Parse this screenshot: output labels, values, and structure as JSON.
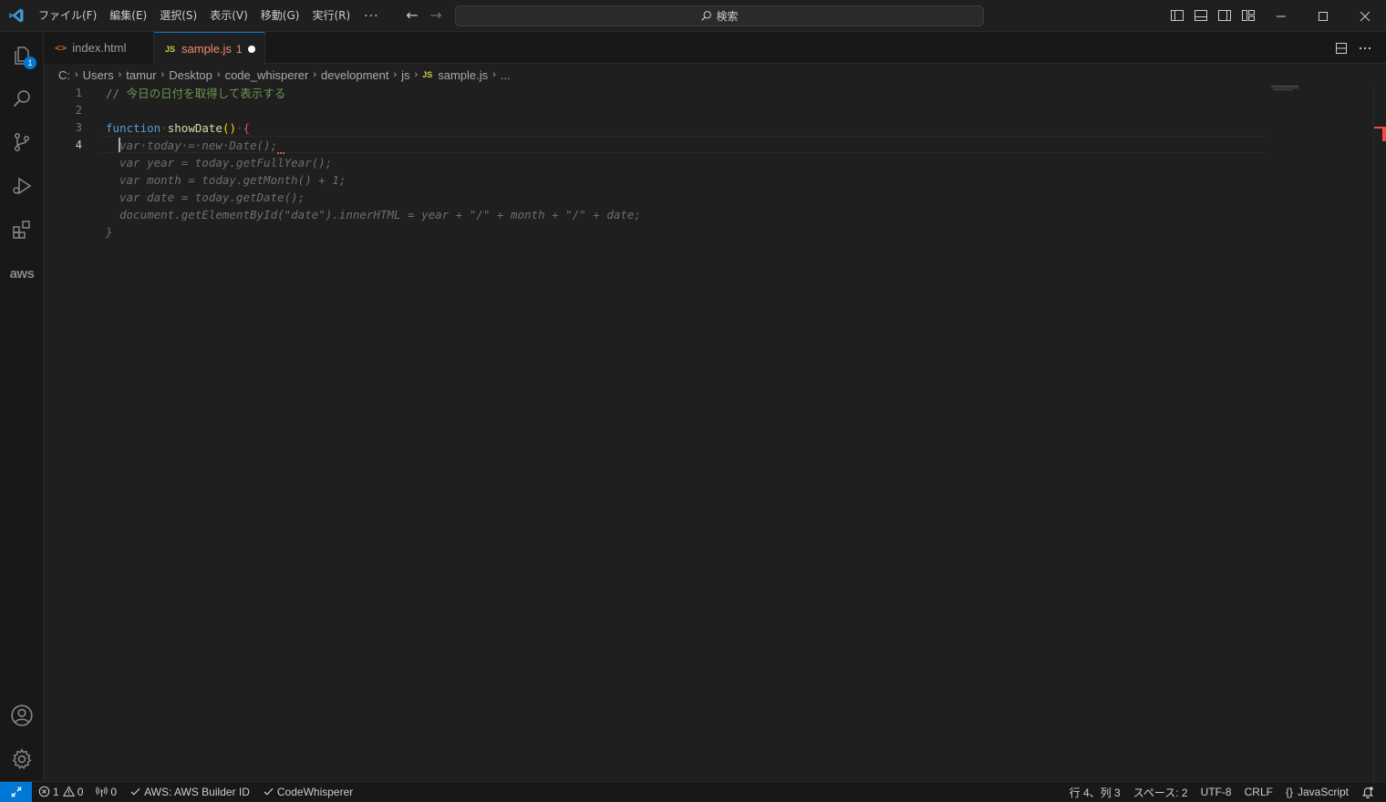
{
  "titlebar": {
    "menu": [
      "ファイル(F)",
      "編集(E)",
      "選択(S)",
      "表示(V)",
      "移動(G)",
      "実行(R)"
    ],
    "more": "···",
    "search_placeholder": "検索"
  },
  "activitybar": {
    "explorer_badge": "1",
    "aws_label": "aws"
  },
  "tabs": [
    {
      "label": "index.html",
      "icon": "html-icon",
      "active": false
    },
    {
      "label": "sample.js",
      "icon_text": "JS",
      "problems": "1",
      "active": true,
      "dirty": true
    }
  ],
  "breadcrumb": {
    "items": [
      "C:",
      "Users",
      "tamur",
      "Desktop",
      "code_whisperer",
      "development",
      "js"
    ],
    "file_icon": "JS",
    "file": "sample.js",
    "more": "..."
  },
  "editor": {
    "line_numbers": [
      "1",
      "2",
      "3",
      "4"
    ],
    "current_line": "4",
    "line1_comment": "// 今日の日付を取得して表示する",
    "line3_keyword": "function",
    "line3_name": "showDate",
    "line3_parens": "()",
    "line3_brace": "{",
    "line4_ghost": "var·today·=·new·Date();",
    "suggestion": [
      "var year = today.getFullYear();",
      "var month = today.getMonth() + 1;",
      "var date = today.getDate();",
      "document.getElementById(\"date\").innerHTML = year + \"/\" + month + \"/\" + date;",
      "}"
    ]
  },
  "statusbar": {
    "errors": "1",
    "warnings": "0",
    "ports": "0",
    "aws": "AWS: AWS Builder ID",
    "codewhisperer": "CodeWhisperer",
    "position": "行 4、列 3",
    "spaces": "スペース: 2",
    "encoding": "UTF-8",
    "eol": "CRLF",
    "language": "JavaScript"
  },
  "colors": {
    "accent": "#0078d4",
    "error": "#f14c4c",
    "js_icon": "#cbcb41",
    "html_icon": "#e37933"
  }
}
